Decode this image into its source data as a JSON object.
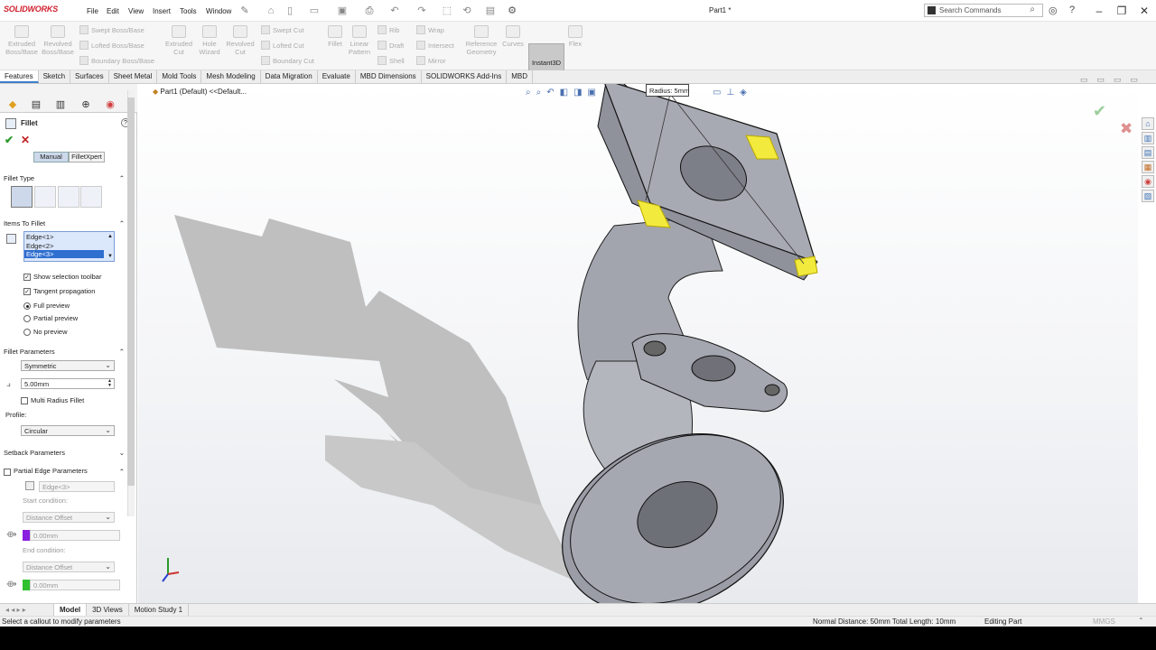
{
  "app": {
    "logo": "SOLIDWORKS",
    "doc_title": "Part1 *"
  },
  "menus": [
    "File",
    "Edit",
    "View",
    "Insert",
    "Tools",
    "Window"
  ],
  "search": {
    "placeholder": "Search Commands"
  },
  "ribbon": {
    "extruded_boss": "Extruded\nBoss/Base",
    "revolved_boss": "Revolved\nBoss/Base",
    "swept_boss": "Swept Boss/Base",
    "lofted_boss": "Lofted Boss/Base",
    "boundary_boss": "Boundary Boss/Base",
    "extruded_cut": "Extruded\nCut",
    "hole_wizard": "Hole\nWizard",
    "revolved_cut": "Revolved\nCut",
    "swept_cut": "Swept Cut",
    "lofted_cut": "Lofted Cut",
    "boundary_cut": "Boundary Cut",
    "fillet": "Fillet",
    "linear_pattern": "Linear\nPattern",
    "rib": "Rib",
    "draft": "Draft",
    "shell": "Shell",
    "wrap": "Wrap",
    "intersect": "Intersect",
    "mirror": "Mirror",
    "reference_geometry": "Reference\nGeometry",
    "curves": "Curves",
    "instant3d": "Instant3D",
    "flex": "Flex"
  },
  "tabs": [
    "Features",
    "Sketch",
    "Surfaces",
    "Sheet Metal",
    "Mold Tools",
    "Mesh Modeling",
    "Data Migration",
    "Evaluate",
    "MBD Dimensions",
    "SOLIDWORKS Add-Ins",
    "MBD"
  ],
  "tree_label": "Part1 (Default) <<Default...",
  "callout": {
    "label": "Radius:",
    "value": "5mm"
  },
  "pm": {
    "title": "Fillet",
    "mode_manual": "Manual",
    "mode_filletxpert": "FilletXpert",
    "fillet_type": "Fillet Type",
    "items_to_fillet": "Items To Fillet",
    "edges": [
      "Edge<1>",
      "Edge<2>",
      "Edge<3>"
    ],
    "show_toolbar": "Show selection toolbar",
    "tangent": "Tangent propagation",
    "full_preview": "Full preview",
    "partial_preview": "Partial preview",
    "no_preview": "No preview",
    "fillet_params": "Fillet Parameters",
    "symmetric": "Symmetric",
    "radius": "5.00mm",
    "multi_radius": "Multi Radius Fillet",
    "profile_label": "Profile:",
    "profile": "Circular",
    "setback": "Setback Parameters",
    "partial_edge": "Partial Edge Parameters",
    "partial_edge_ref": "Edge<3>",
    "start_condition": "Start condition:",
    "start_type": "Distance Offset",
    "start_value": "0.00mm",
    "end_condition": "End condition:",
    "end_type": "Distance Offset",
    "end_value": "0.00mm"
  },
  "bottom_tabs": [
    "Model",
    "3D Views",
    "Motion Study 1"
  ],
  "status": {
    "hint": "Select a callout to modify parameters",
    "measure": "Normal Distance: 50mm Total Length: 10mm",
    "mode": "Editing Part",
    "units": "MMGS"
  },
  "colors": {
    "accent": "#3d7ecc",
    "logo": "#d0202e",
    "highlight": "#f2ea3c",
    "model": "#9a9ca6"
  }
}
